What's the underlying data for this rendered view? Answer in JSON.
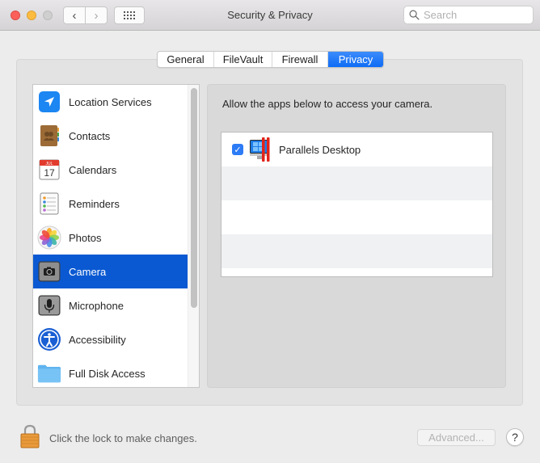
{
  "window": {
    "title": "Security & Privacy",
    "search_placeholder": "Search",
    "nav_back": "‹",
    "nav_forward": "›"
  },
  "tabs": [
    {
      "label": "General",
      "active": false
    },
    {
      "label": "FileVault",
      "active": false
    },
    {
      "label": "Firewall",
      "active": false
    },
    {
      "label": "Privacy",
      "active": true
    }
  ],
  "sidebar": {
    "items": [
      {
        "label": "Location Services",
        "icon": "location-arrow-icon",
        "selected": false
      },
      {
        "label": "Contacts",
        "icon": "contacts-book-icon",
        "selected": false
      },
      {
        "label": "Calendars",
        "icon": "calendar-icon",
        "selected": false,
        "icon_text": "17",
        "icon_month": "JUL"
      },
      {
        "label": "Reminders",
        "icon": "reminders-list-icon",
        "selected": false
      },
      {
        "label": "Photos",
        "icon": "photos-flower-icon",
        "selected": false
      },
      {
        "label": "Camera",
        "icon": "camera-icon",
        "selected": true
      },
      {
        "label": "Microphone",
        "icon": "microphone-icon",
        "selected": false
      },
      {
        "label": "Accessibility",
        "icon": "accessibility-icon",
        "selected": false
      },
      {
        "label": "Full Disk Access",
        "icon": "folder-icon",
        "selected": false
      }
    ]
  },
  "panel": {
    "description": "Allow the apps below to access your camera.",
    "apps": [
      {
        "name": "Parallels Desktop",
        "checked": true,
        "icon": "parallels-desktop-icon"
      }
    ],
    "checkmark": "✓"
  },
  "footer": {
    "lock_text": "Click the lock to make changes.",
    "advanced_label": "Advanced...",
    "help_label": "?"
  },
  "colors": {
    "accent": "#0a59d2",
    "tab_active": "#1a73f7",
    "checkbox": "#2d7cf6"
  }
}
